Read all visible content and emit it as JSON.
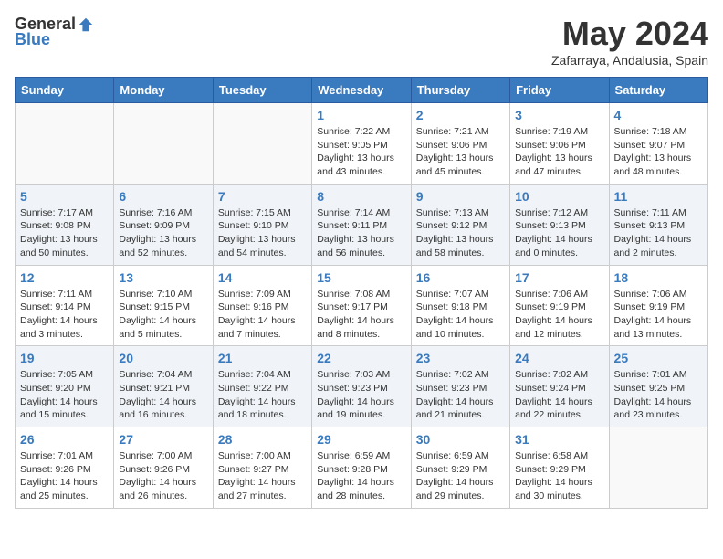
{
  "logo": {
    "general": "General",
    "blue": "Blue"
  },
  "title": {
    "month": "May 2024",
    "location": "Zafarraya, Andalusia, Spain"
  },
  "weekdays": [
    "Sunday",
    "Monday",
    "Tuesday",
    "Wednesday",
    "Thursday",
    "Friday",
    "Saturday"
  ],
  "weeks": [
    [
      {
        "day": "",
        "info": ""
      },
      {
        "day": "",
        "info": ""
      },
      {
        "day": "",
        "info": ""
      },
      {
        "day": "1",
        "info": "Sunrise: 7:22 AM\nSunset: 9:05 PM\nDaylight: 13 hours\nand 43 minutes."
      },
      {
        "day": "2",
        "info": "Sunrise: 7:21 AM\nSunset: 9:06 PM\nDaylight: 13 hours\nand 45 minutes."
      },
      {
        "day": "3",
        "info": "Sunrise: 7:19 AM\nSunset: 9:06 PM\nDaylight: 13 hours\nand 47 minutes."
      },
      {
        "day": "4",
        "info": "Sunrise: 7:18 AM\nSunset: 9:07 PM\nDaylight: 13 hours\nand 48 minutes."
      }
    ],
    [
      {
        "day": "5",
        "info": "Sunrise: 7:17 AM\nSunset: 9:08 PM\nDaylight: 13 hours\nand 50 minutes."
      },
      {
        "day": "6",
        "info": "Sunrise: 7:16 AM\nSunset: 9:09 PM\nDaylight: 13 hours\nand 52 minutes."
      },
      {
        "day": "7",
        "info": "Sunrise: 7:15 AM\nSunset: 9:10 PM\nDaylight: 13 hours\nand 54 minutes."
      },
      {
        "day": "8",
        "info": "Sunrise: 7:14 AM\nSunset: 9:11 PM\nDaylight: 13 hours\nand 56 minutes."
      },
      {
        "day": "9",
        "info": "Sunrise: 7:13 AM\nSunset: 9:12 PM\nDaylight: 13 hours\nand 58 minutes."
      },
      {
        "day": "10",
        "info": "Sunrise: 7:12 AM\nSunset: 9:13 PM\nDaylight: 14 hours\nand 0 minutes."
      },
      {
        "day": "11",
        "info": "Sunrise: 7:11 AM\nSunset: 9:13 PM\nDaylight: 14 hours\nand 2 minutes."
      }
    ],
    [
      {
        "day": "12",
        "info": "Sunrise: 7:11 AM\nSunset: 9:14 PM\nDaylight: 14 hours\nand 3 minutes."
      },
      {
        "day": "13",
        "info": "Sunrise: 7:10 AM\nSunset: 9:15 PM\nDaylight: 14 hours\nand 5 minutes."
      },
      {
        "day": "14",
        "info": "Sunrise: 7:09 AM\nSunset: 9:16 PM\nDaylight: 14 hours\nand 7 minutes."
      },
      {
        "day": "15",
        "info": "Sunrise: 7:08 AM\nSunset: 9:17 PM\nDaylight: 14 hours\nand 8 minutes."
      },
      {
        "day": "16",
        "info": "Sunrise: 7:07 AM\nSunset: 9:18 PM\nDaylight: 14 hours\nand 10 minutes."
      },
      {
        "day": "17",
        "info": "Sunrise: 7:06 AM\nSunset: 9:19 PM\nDaylight: 14 hours\nand 12 minutes."
      },
      {
        "day": "18",
        "info": "Sunrise: 7:06 AM\nSunset: 9:19 PM\nDaylight: 14 hours\nand 13 minutes."
      }
    ],
    [
      {
        "day": "19",
        "info": "Sunrise: 7:05 AM\nSunset: 9:20 PM\nDaylight: 14 hours\nand 15 minutes."
      },
      {
        "day": "20",
        "info": "Sunrise: 7:04 AM\nSunset: 9:21 PM\nDaylight: 14 hours\nand 16 minutes."
      },
      {
        "day": "21",
        "info": "Sunrise: 7:04 AM\nSunset: 9:22 PM\nDaylight: 14 hours\nand 18 minutes."
      },
      {
        "day": "22",
        "info": "Sunrise: 7:03 AM\nSunset: 9:23 PM\nDaylight: 14 hours\nand 19 minutes."
      },
      {
        "day": "23",
        "info": "Sunrise: 7:02 AM\nSunset: 9:23 PM\nDaylight: 14 hours\nand 21 minutes."
      },
      {
        "day": "24",
        "info": "Sunrise: 7:02 AM\nSunset: 9:24 PM\nDaylight: 14 hours\nand 22 minutes."
      },
      {
        "day": "25",
        "info": "Sunrise: 7:01 AM\nSunset: 9:25 PM\nDaylight: 14 hours\nand 23 minutes."
      }
    ],
    [
      {
        "day": "26",
        "info": "Sunrise: 7:01 AM\nSunset: 9:26 PM\nDaylight: 14 hours\nand 25 minutes."
      },
      {
        "day": "27",
        "info": "Sunrise: 7:00 AM\nSunset: 9:26 PM\nDaylight: 14 hours\nand 26 minutes."
      },
      {
        "day": "28",
        "info": "Sunrise: 7:00 AM\nSunset: 9:27 PM\nDaylight: 14 hours\nand 27 minutes."
      },
      {
        "day": "29",
        "info": "Sunrise: 6:59 AM\nSunset: 9:28 PM\nDaylight: 14 hours\nand 28 minutes."
      },
      {
        "day": "30",
        "info": "Sunrise: 6:59 AM\nSunset: 9:29 PM\nDaylight: 14 hours\nand 29 minutes."
      },
      {
        "day": "31",
        "info": "Sunrise: 6:58 AM\nSunset: 9:29 PM\nDaylight: 14 hours\nand 30 minutes."
      },
      {
        "day": "",
        "info": ""
      }
    ]
  ]
}
